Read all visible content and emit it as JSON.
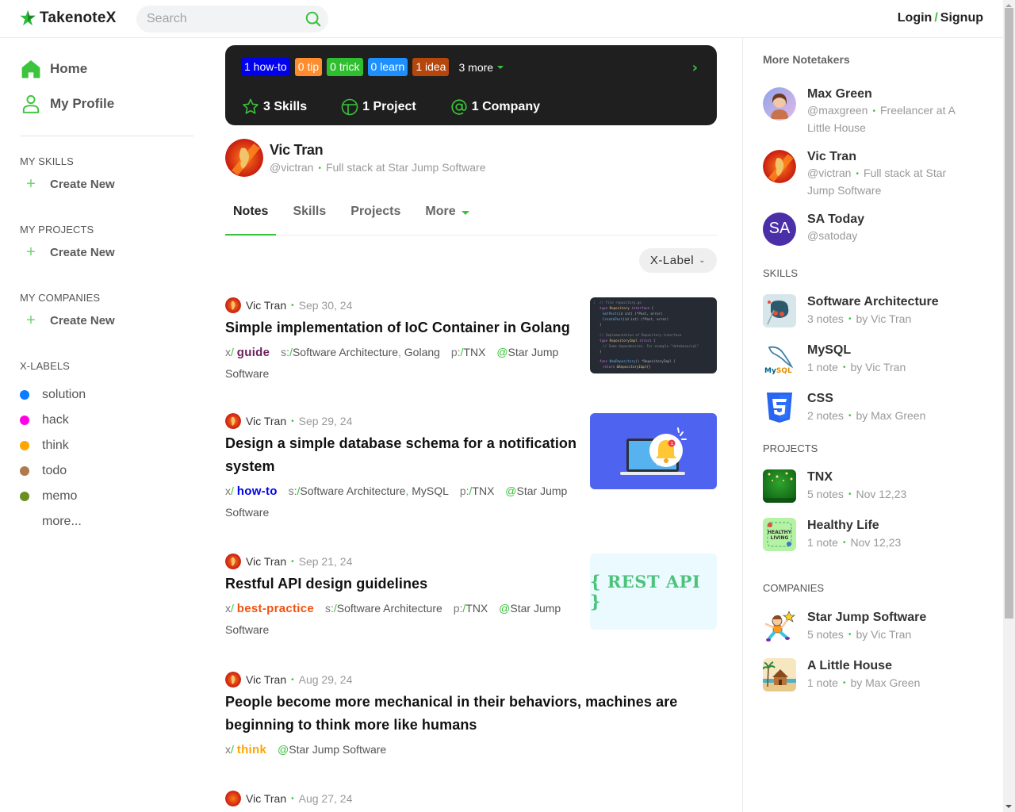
{
  "header": {
    "logo_text": "TakenoteX",
    "search_placeholder": "Search",
    "login": "Login",
    "separator": "/",
    "signup": "Signup"
  },
  "left_nav": {
    "home": "Home",
    "profile": "My Profile",
    "sections": [
      {
        "title": "MY SKILLS",
        "action": "Create New"
      },
      {
        "title": "MY PROJECTS",
        "action": "Create New"
      },
      {
        "title": "MY COMPANIES",
        "action": "Create New"
      }
    ],
    "xlabels_title": "X-LABELS",
    "xlabels": [
      {
        "label": "solution",
        "color": "#0a7cff"
      },
      {
        "label": "hack",
        "color": "#ff00e6"
      },
      {
        "label": "think",
        "color": "#ffa500"
      },
      {
        "label": "todo",
        "color": "#b07a4f"
      },
      {
        "label": "memo",
        "color": "#6b8e23"
      }
    ],
    "xlabels_more": "more..."
  },
  "stats": {
    "tags": [
      {
        "label": "1 how-to",
        "color": "#0000ee"
      },
      {
        "label": "0 tip",
        "color": "#ff8c2e"
      },
      {
        "label": "0 trick",
        "color": "#2fbe2f"
      },
      {
        "label": "0 learn",
        "color": "#1e8fff"
      },
      {
        "label": "1 idea",
        "color": "#b5460c"
      }
    ],
    "more": "3 more",
    "skills": "3 Skills",
    "projects": "1 Project",
    "companies": "1 Company"
  },
  "profile": {
    "name": "Vic Tran",
    "handle": "@victran",
    "role": "Full stack at Star Jump Software"
  },
  "tabs": [
    {
      "label": "Notes",
      "active": true
    },
    {
      "label": "Skills"
    },
    {
      "label": "Projects"
    },
    {
      "label": "More"
    }
  ],
  "filter": {
    "label": "X-Label"
  },
  "notes": [
    {
      "author": "Vic Tran",
      "date": "Sep 30, 24",
      "title": "Simple implementation of IoC Container in Golang",
      "xlabel": "guide",
      "xlabel_color": "#6b1f5e",
      "skills": [
        "Software Architecture",
        "Golang"
      ],
      "project": "TNX",
      "company": "Star Jump Software",
      "thumb": "code-snippet"
    },
    {
      "author": "Vic Tran",
      "date": "Sep 29, 24",
      "title": "Design a simple database schema for a notification system",
      "xlabel": "how-to",
      "xlabel_color": "#0000ee",
      "skills": [
        "Software Architecture",
        "MySQL"
      ],
      "project": "TNX",
      "company": "Star Jump Software",
      "thumb": "notification-bell"
    },
    {
      "author": "Vic Tran",
      "date": "Sep 21, 24",
      "title": "Restful API design guidelines",
      "xlabel": "best-practice",
      "xlabel_color": "#f0520f",
      "skills": [
        "Software Architecture"
      ],
      "project": "TNX",
      "company": "Star Jump Software",
      "thumb": "rest-api",
      "thumb_text": "{ REST API }"
    },
    {
      "author": "Vic Tran",
      "date": "Aug 29, 24",
      "title": "People become more mechanical in their behaviors, machines are beginning to think more like humans",
      "xlabel": "think",
      "xlabel_color": "#ffa500",
      "company": "Star Jump Software"
    },
    {
      "author": "Vic Tran",
      "date": "Aug 27, 24"
    }
  ],
  "right": {
    "notetakers_title": "More Notetakers",
    "notetakers": [
      {
        "name": "Max Green",
        "handle": "@maxgreen",
        "role": "Freelancer at A Little House"
      },
      {
        "name": "Vic Tran",
        "handle": "@victran",
        "role": "Full stack at Star Jump Software"
      },
      {
        "name": "SA Today",
        "handle": "@satoday",
        "initials": "SA"
      }
    ],
    "skills_title": "SKILLS",
    "skills": [
      {
        "name": "Software Architecture",
        "count": "3 notes",
        "by": "by Vic Tran"
      },
      {
        "name": "MySQL",
        "count": "1 note",
        "by": "by Vic Tran"
      },
      {
        "name": "CSS",
        "count": "2 notes",
        "by": "by Max Green"
      }
    ],
    "projects_title": "PROJECTS",
    "projects": [
      {
        "name": "TNX",
        "count": "5 notes",
        "date": "Nov 12,23"
      },
      {
        "name": "Healthy Life",
        "count": "1 note",
        "date": "Nov 12,23"
      }
    ],
    "companies_title": "COMPANIES",
    "companies": [
      {
        "name": "Star Jump Software",
        "count": "5 notes",
        "by": "by Vic Tran"
      },
      {
        "name": "A Little House",
        "count": "1 note",
        "by": "by Max Green"
      }
    ]
  }
}
